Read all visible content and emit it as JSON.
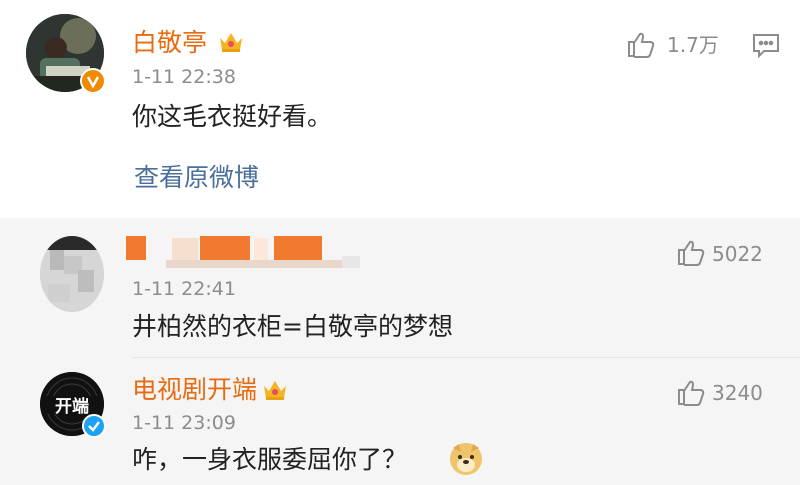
{
  "main_comment": {
    "username": "白敬亭",
    "time": "1-11 22:38",
    "text": "你这毛衣挺好看。",
    "like_count": "1.7万",
    "view_original_label": "查看原微博",
    "badge_color": "#f5a623"
  },
  "replies": [
    {
      "username": "",
      "time": "1-11 22:41",
      "text": "井柏然的衣柜=白敬亭的梦想",
      "like_count": "5022"
    },
    {
      "username": "电视剧开端",
      "time": "1-11 23:09",
      "text": "咋，一身衣服委屈你了？",
      "like_count": "3240",
      "avatar_text": "开端"
    }
  ],
  "colors": {
    "username": "#e86b0f",
    "link": "#4a6f9b",
    "reply_bg": "#f5f5f5",
    "verified_blue": "#1da1f2",
    "verified_orange": "#f08a00"
  }
}
